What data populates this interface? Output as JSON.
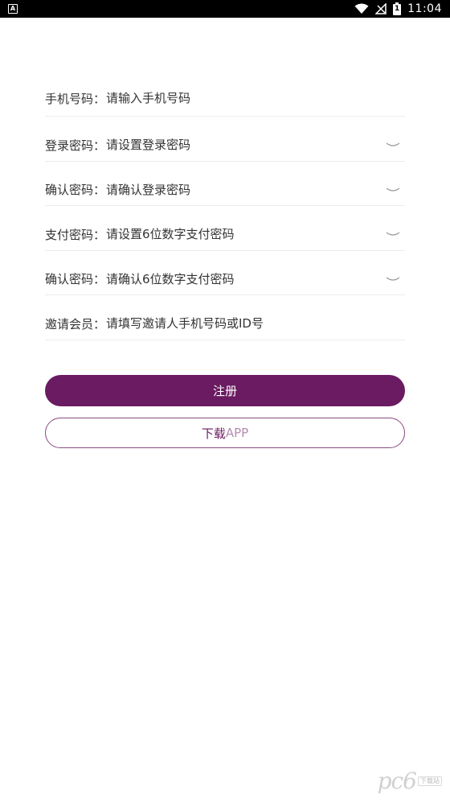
{
  "status_bar": {
    "notification_icon": "A",
    "battery_level": "1",
    "time": "11:04"
  },
  "form": {
    "rows": [
      {
        "label": "手机号码：",
        "placeholder": "请输入手机号码",
        "has_eye": false
      },
      {
        "label": "登录密码：",
        "placeholder": "请设置登录密码",
        "has_eye": true
      },
      {
        "label": "确认密码：",
        "placeholder": "请确认登录密码",
        "has_eye": true
      },
      {
        "label": "支付密码：",
        "placeholder": "请设置6位数字支付密码",
        "has_eye": true
      },
      {
        "label": "确认密码：",
        "placeholder": "请确认6位数字支付密码",
        "has_eye": true
      },
      {
        "label": "邀请会员：",
        "placeholder": "请填写邀请人手机号码或ID号",
        "has_eye": false
      }
    ]
  },
  "buttons": {
    "register": "注册",
    "download_prefix": "下载",
    "download_suffix": "APP"
  },
  "watermark": {
    "logo": "pc6",
    "site": "下载站"
  },
  "colors": {
    "accent": "#6a1b61",
    "divider": "#ececec",
    "text": "#333333"
  }
}
